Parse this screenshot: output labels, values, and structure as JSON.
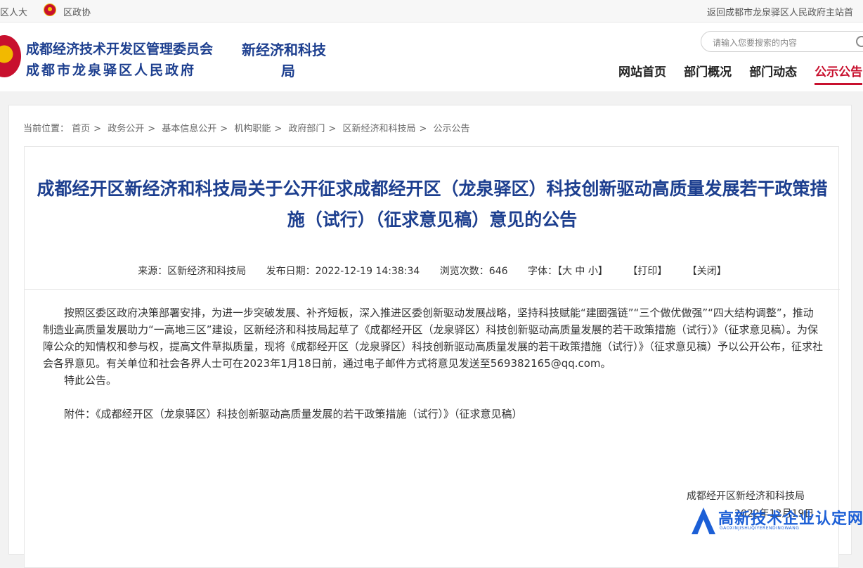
{
  "topbar": {
    "link1": "区人大",
    "link2": "区政协",
    "return": "返回成都市龙泉驿区人民政府主站首"
  },
  "header": {
    "org_line1": "成都经济技术开发区管理委员会",
    "org_line2": "成都市龙泉驿区人民政府",
    "dept_line1": "新经济和科技",
    "dept_line2": "局",
    "search_placeholder": "请输入您要搜索的内容",
    "nav": [
      "网站首页",
      "部门概况",
      "部门动态",
      "公示公告"
    ]
  },
  "breadcrumb": {
    "prefix": "当前位置：",
    "items": [
      "首页",
      "政务公开",
      "基本信息公开",
      "机构职能",
      "政府部门",
      "区新经济和科技局",
      "公示公告"
    ]
  },
  "article": {
    "title": "成都经开区新经济和科技局关于公开征求成都经开区（龙泉驿区）科技创新驱动高质量发展若干政策措施（试行）（征求意见稿）意见的公告",
    "source": "来源：区新经济和科技局",
    "date": "发布日期：2022-12-19 14:38:34",
    "views": "浏览次数：646",
    "font_label": "字体：【大 中 小】",
    "print": "【打印】",
    "close": "【关闭】",
    "paragraph1": "按照区委区政府决策部署安排，为进一步突破发展、补齐短板，深入推进区委创新驱动发展战略，坚持科技赋能“建圈强链”“三个做优做强”“四大结构调整”，推动制造业高质量发展助力“一高地三区”建设，区新经济和科技局起草了《成都经开区（龙泉驿区）科技创新驱动高质量发展的若干政策措施（试行）》（征求意见稿）。为保障公众的知情权和参与权，提高文件草拟质量，现将《成都经开区（龙泉驿区）科技创新驱动高质量发展的若干政策措施（试行）》（征求意见稿）予以公开公布，征求社会各界意见。有关单位和社会各界人士可在2023年1月18日前，通过电子邮件方式将意见发送至569382165@qq.com。",
    "paragraph2": "特此公告。",
    "attachment": "附件：《成都经开区（龙泉驿区）科技创新驱动高质量发展的若干政策措施（试行）》（征求意见稿）",
    "signature": "成都经开区新经济和科技局",
    "sign_date": "2022年12月19日"
  },
  "watermark": {
    "title": "高新技术企业认定网",
    "sub": "GAOXINJISHUQIYERENDINGWANG"
  }
}
